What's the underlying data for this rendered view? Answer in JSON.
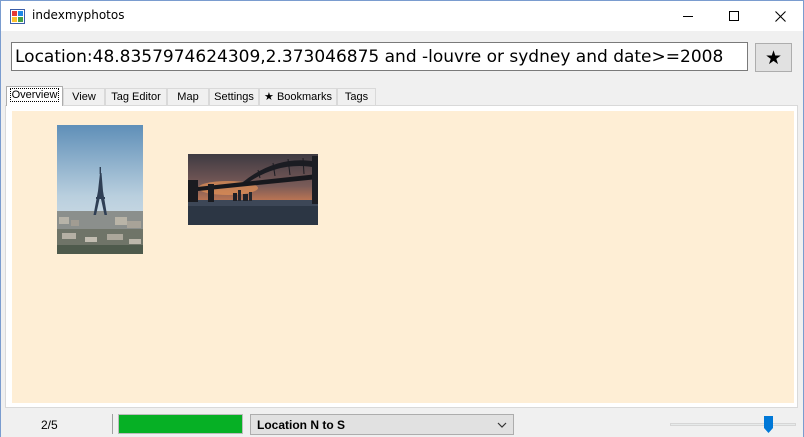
{
  "window": {
    "title": "indexmyphotos",
    "icon": "app-icon",
    "controls": [
      "minimize-icon",
      "maximize-icon",
      "close-icon"
    ]
  },
  "search": {
    "value": "Location:48.8357974624309,2.373046875 and -louvre or sydney and date>=2008",
    "bookmark_label": "★"
  },
  "tabs": [
    {
      "label": "Overview",
      "active": true
    },
    {
      "label": "View"
    },
    {
      "label": "Tag Editor"
    },
    {
      "label": "Map"
    },
    {
      "label": "Settings"
    },
    {
      "label": "★ Bookmarks"
    },
    {
      "label": "Tags"
    }
  ],
  "photos": [
    {
      "subject": "eiffel-tower-paris"
    },
    {
      "subject": "sydney-harbour-bridge"
    }
  ],
  "status": {
    "count": "2/5",
    "progress_percent": 100,
    "sort_value": "Location N to S",
    "slider_fraction": 0.8
  },
  "colors": {
    "content_bg": "#feeed5",
    "progress": "#06b025",
    "accent": "#0078d7"
  }
}
